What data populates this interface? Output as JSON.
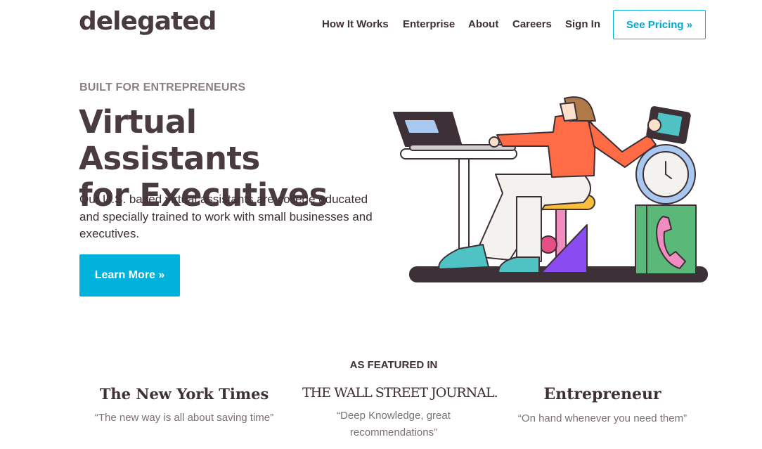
{
  "brand": {
    "logo_text": "delegated"
  },
  "nav": {
    "items": [
      {
        "label": "How It Works"
      },
      {
        "label": "Enterprise"
      },
      {
        "label": "About"
      },
      {
        "label": "Careers"
      },
      {
        "label": "Sign In"
      }
    ],
    "cta_label": "See Pricing »"
  },
  "hero": {
    "eyebrow": "BUILT FOR ENTREPRENEURS",
    "title_line1": "Virtual Assistants",
    "title_line2": "for Executives",
    "description": "Our U.S. based virtual assistants are college educated and specially trained to work with small businesses and executives.",
    "cta_label": "Learn More »"
  },
  "featured": {
    "heading": "AS FEATURED IN",
    "items": [
      {
        "outlet": "The New York Times",
        "quote": "“The new way is all about saving time”"
      },
      {
        "outlet": "THE WALL STREET JOURNAL.",
        "quote": "“Deep Knowledge, great recommendations”"
      },
      {
        "outlet": "Entrepreneur",
        "quote": "“On hand whenever you need them”"
      }
    ]
  },
  "colors": {
    "accent": "#00b2dc",
    "text_dark": "#4a3b40",
    "illustration_orange": "#ff6b45",
    "illustration_teal": "#4fc3c4",
    "illustration_green": "#5ab878",
    "illustration_pink": "#f08cc0",
    "illustration_purple": "#8a4cf0",
    "illustration_yellow": "#f7bd3b"
  }
}
